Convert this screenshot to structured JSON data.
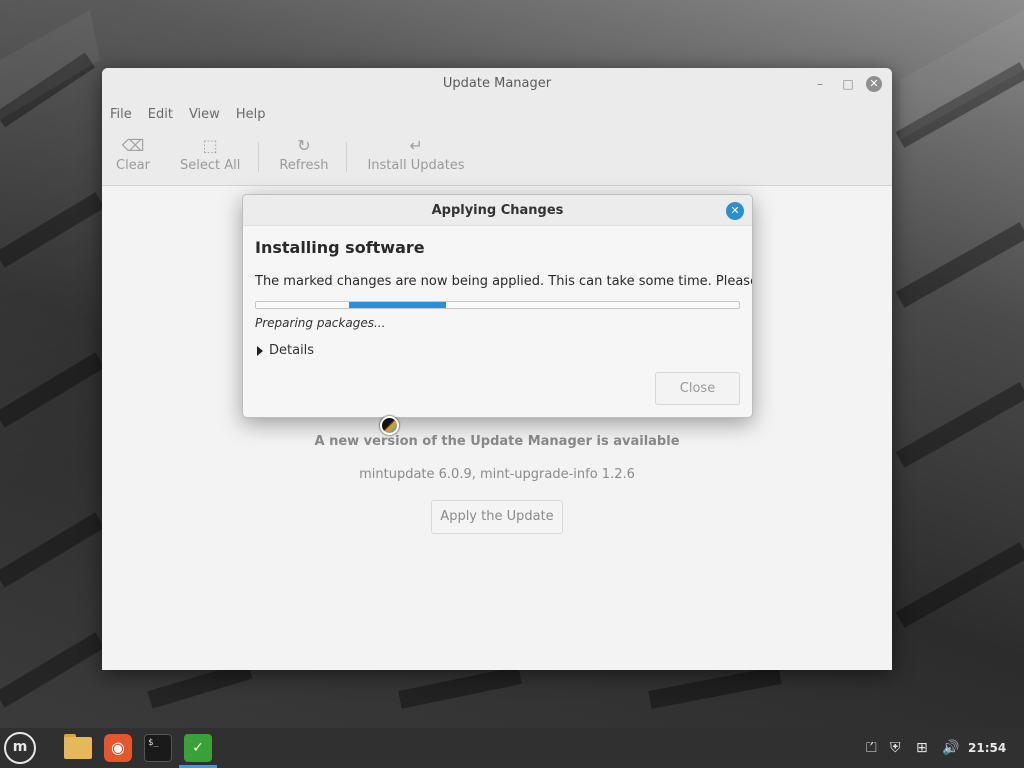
{
  "window": {
    "title": "Update Manager",
    "controls": {
      "minimize": "–",
      "maximize": "□",
      "close": "✕"
    }
  },
  "menubar": {
    "items": [
      {
        "label": "File"
      },
      {
        "label": "Edit"
      },
      {
        "label": "View"
      },
      {
        "label": "Help"
      }
    ]
  },
  "toolbar": {
    "clear": {
      "label": "Clear",
      "icon": "backspace-icon",
      "glyph": "⌫"
    },
    "select_all": {
      "label": "Select All",
      "icon": "select-all-icon",
      "glyph": "⬚"
    },
    "refresh": {
      "label": "Refresh",
      "icon": "refresh-icon",
      "glyph": "↻"
    },
    "install": {
      "label": "Install Updates",
      "icon": "install-icon",
      "glyph": "↵"
    }
  },
  "main": {
    "available_title": "A new version of the Update Manager is available",
    "available_versions": "mintupdate 6.0.9, mint-upgrade-info 1.2.6",
    "apply_button": "Apply the Update"
  },
  "dialog": {
    "title": "Applying Changes",
    "close_glyph": "✕",
    "heading": "Installing software",
    "message": "The marked changes are now being applied. This can take some time. Please wait.",
    "progress_fraction": 0.2,
    "status": "Preparing packages...",
    "details_label": "Details",
    "close_button": "Close",
    "accent_color": "#2e8fd8"
  },
  "taskbar": {
    "menu_glyph": "m",
    "terminal_glyph": "$_",
    "firefox_glyph": "◉",
    "update_glyph": "✓",
    "tray": {
      "updates_glyph": "⏍",
      "shield_glyph": "⛨",
      "network_glyph": "⊞",
      "volume_glyph": "🔊",
      "clock": "21:54"
    }
  }
}
